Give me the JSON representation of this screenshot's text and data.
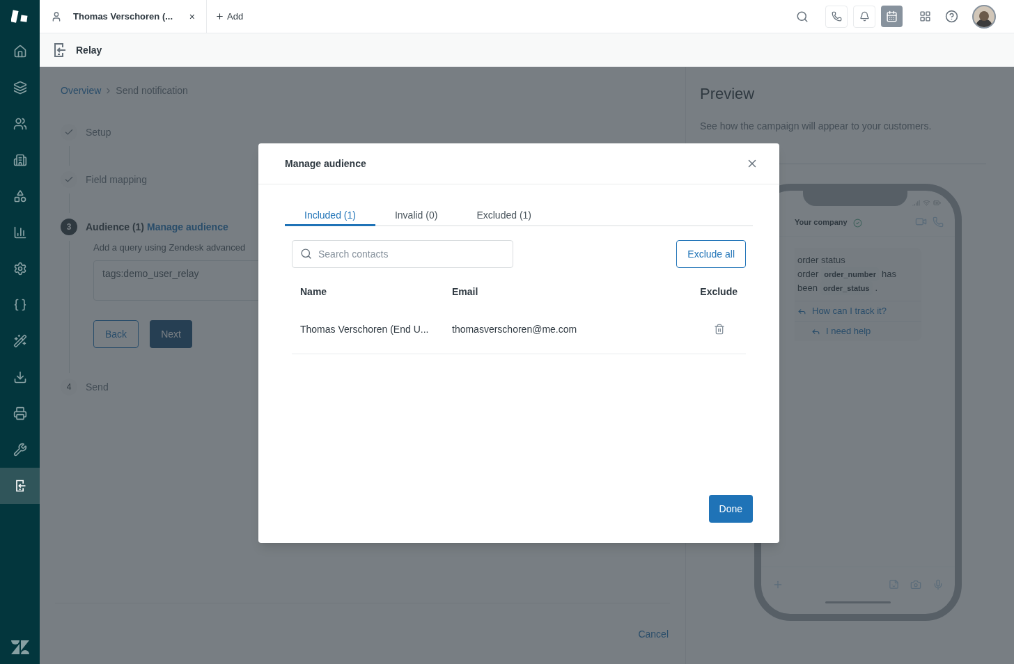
{
  "nav": {
    "items": [
      {
        "selected": false
      },
      {
        "selected": false
      },
      {
        "selected": false
      },
      {
        "selected": false
      },
      {
        "selected": false
      },
      {
        "selected": false
      },
      {
        "selected": false
      },
      {
        "selected": false
      },
      {
        "selected": false
      },
      {
        "selected": false
      },
      {
        "selected": false
      },
      {
        "selected": false
      },
      {
        "selected": true
      }
    ]
  },
  "top_bar": {
    "tab": {
      "title": "Thomas Verschoren (...",
      "close": "×"
    },
    "add": "Add"
  },
  "header": {
    "title": "Relay"
  },
  "breadcrumb": [
    "Overview",
    "Send notification"
  ],
  "steps": [
    {
      "kind": "done",
      "label": "Setup"
    },
    {
      "kind": "done",
      "label": "Field mapping"
    },
    {
      "kind": "current",
      "number": "3",
      "label": "Audience (1)",
      "link": "Manage audience",
      "hint": "Add a query using Zendesk advanced",
      "query": "tags:demo_user_relay",
      "buttons": [
        "Back",
        "Next"
      ]
    },
    {
      "kind": "pending",
      "number": "4",
      "label": "Send"
    }
  ],
  "footer": {
    "cancel": "Cancel"
  },
  "preview": {
    "title": "Preview",
    "description": "See how the campaign will appear to your customers.",
    "company": "Your company",
    "message": [
      {
        "kind": "word",
        "text": "order status"
      },
      {
        "kind": "break"
      },
      {
        "kind": "word",
        "text": "order"
      },
      {
        "kind": "chip",
        "text": "order_number"
      },
      {
        "kind": "word",
        "text": "has"
      },
      {
        "kind": "break"
      },
      {
        "kind": "word",
        "text": "been"
      },
      {
        "kind": "chip",
        "text": "order_status"
      },
      {
        "kind": "word",
        "text": "."
      }
    ],
    "replies": [
      "How can I track it?",
      "I need help"
    ]
  },
  "modal": {
    "title": "Manage audience",
    "tabs": [
      {
        "label": "Included (1)",
        "selected": true
      },
      {
        "label": "Invalid (0)",
        "selected": false
      },
      {
        "label": "Excluded (1)",
        "selected": false
      }
    ],
    "search": {
      "placeholder": "Search contacts"
    },
    "exclude_all": "Exclude all",
    "columns": [
      "Name",
      "Email",
      "Exclude"
    ],
    "rows": [
      {
        "name": "Thomas Verschoren (End U...",
        "email": "thomasverschoren@me.com"
      }
    ],
    "done": "Done"
  }
}
